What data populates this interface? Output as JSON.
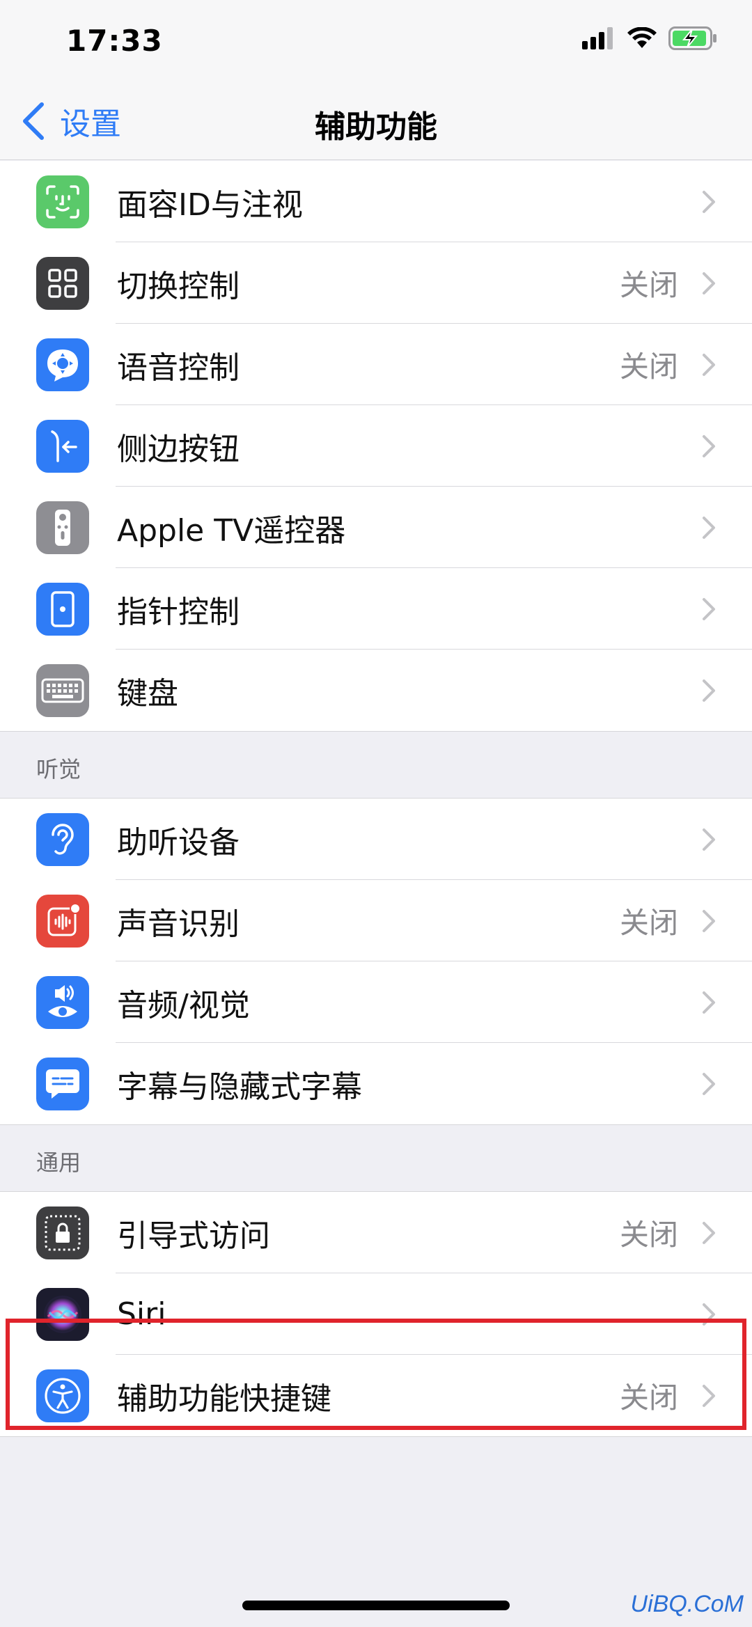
{
  "status": {
    "time": "17:33"
  },
  "nav": {
    "back_label": "设置",
    "title": "辅助功能"
  },
  "group_top": [
    {
      "label": "面容ID与注视",
      "value": "",
      "icon": "face-id-icon",
      "color": "#5ac96a"
    },
    {
      "label": "切换控制",
      "value": "关闭",
      "icon": "switch-control-icon",
      "color": "#3e3e40"
    },
    {
      "label": "语音控制",
      "value": "关闭",
      "icon": "voice-control-icon",
      "color": "#2f7cf6"
    },
    {
      "label": "侧边按钮",
      "value": "",
      "icon": "side-button-icon",
      "color": "#2f7cf6"
    },
    {
      "label": "Apple TV遥控器",
      "value": "",
      "icon": "tv-remote-icon",
      "color": "#8e8e93"
    },
    {
      "label": "指针控制",
      "value": "",
      "icon": "pointer-control-icon",
      "color": "#2f7cf6"
    },
    {
      "label": "键盘",
      "value": "",
      "icon": "keyboard-icon",
      "color": "#8e8e93"
    }
  ],
  "hearing": {
    "header": "听觉",
    "items": [
      {
        "label": "助听设备",
        "value": "",
        "icon": "hearing-device-icon",
        "color": "#2f7cf6"
      },
      {
        "label": "声音识别",
        "value": "关闭",
        "icon": "sound-recognition-icon",
        "color": "#e5473c"
      },
      {
        "label": "音频/视觉",
        "value": "",
        "icon": "audio-visual-icon",
        "color": "#2f7cf6"
      },
      {
        "label": "字幕与隐藏式字幕",
        "value": "",
        "icon": "subtitles-icon",
        "color": "#2f7cf6"
      }
    ]
  },
  "general": {
    "header": "通用",
    "items": [
      {
        "label": "引导式访问",
        "value": "关闭",
        "icon": "guided-access-icon",
        "color": "#3e3e40"
      },
      {
        "label": "Siri",
        "value": "",
        "icon": "siri-icon",
        "color": "#1c1c2e"
      },
      {
        "label": "辅助功能快捷键",
        "value": "关闭",
        "icon": "accessibility-shortcut-icon",
        "color": "#2f7cf6"
      }
    ]
  },
  "watermark": "UiBQ.CoM"
}
